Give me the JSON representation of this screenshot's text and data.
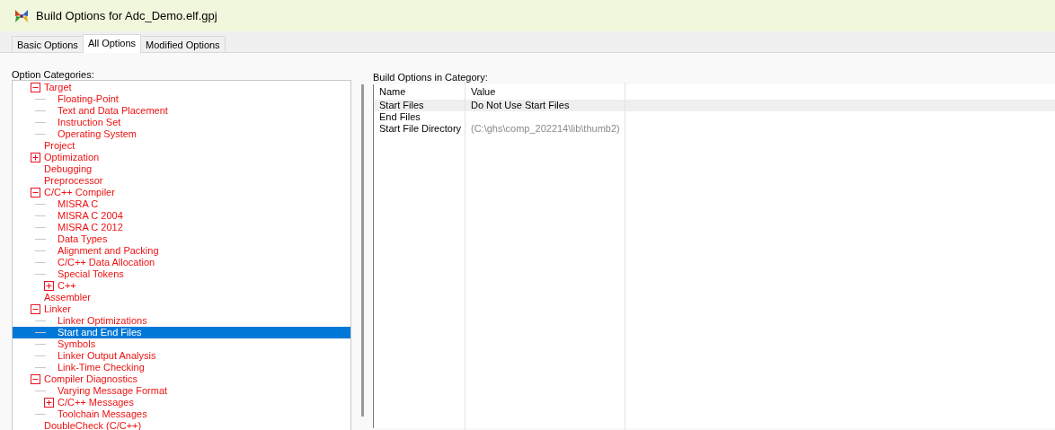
{
  "window": {
    "title": "Build Options for Adc_Demo.elf.gpj"
  },
  "tabs": [
    {
      "label": "Basic Options",
      "selected": false
    },
    {
      "label": "All Options",
      "selected": true
    },
    {
      "label": "Modified Options",
      "selected": false
    }
  ],
  "categories": {
    "label": "Option Categories:",
    "items": [
      {
        "label": "Target",
        "expanded": true,
        "selected": false,
        "children": [
          {
            "label": "Floating-Point",
            "selected": false
          },
          {
            "label": "Text and Data Placement",
            "selected": false
          },
          {
            "label": "Instruction Set",
            "selected": false
          },
          {
            "label": "Operating System",
            "selected": false
          }
        ]
      },
      {
        "label": "Project",
        "selected": false
      },
      {
        "label": "Optimization",
        "expanded": false,
        "selected": false
      },
      {
        "label": "Debugging",
        "selected": false
      },
      {
        "label": "Preprocessor",
        "selected": false
      },
      {
        "label": "C/C++ Compiler",
        "expanded": true,
        "selected": false,
        "children": [
          {
            "label": "MISRA C",
            "selected": false
          },
          {
            "label": "MISRA C 2004",
            "selected": false
          },
          {
            "label": "MISRA C 2012",
            "selected": false
          },
          {
            "label": "Data Types",
            "selected": false
          },
          {
            "label": "Alignment and Packing",
            "selected": false
          },
          {
            "label": "C/C++ Data Allocation",
            "selected": false
          },
          {
            "label": "Special Tokens",
            "selected": false
          },
          {
            "label": "C++",
            "expanded": false,
            "selected": false
          }
        ]
      },
      {
        "label": "Assembler",
        "selected": false
      },
      {
        "label": "Linker",
        "expanded": true,
        "selected": false,
        "children": [
          {
            "label": "Linker Optimizations",
            "selected": false
          },
          {
            "label": "Start and End Files",
            "selected": true
          },
          {
            "label": "Symbols",
            "selected": false
          },
          {
            "label": "Linker Output Analysis",
            "selected": false
          },
          {
            "label": "Link-Time Checking",
            "selected": false
          }
        ]
      },
      {
        "label": "Compiler Diagnostics",
        "expanded": true,
        "selected": false,
        "children": [
          {
            "label": "Varying Message Format",
            "selected": false
          },
          {
            "label": "C/C++ Messages",
            "expanded": false,
            "selected": false
          },
          {
            "label": "Toolchain Messages",
            "selected": false
          }
        ]
      },
      {
        "label": "DoubleCheck (C/C++)",
        "selected": false
      }
    ]
  },
  "options": {
    "label": "Build Options in Category:",
    "columns": [
      "Name",
      "Value"
    ],
    "rows": [
      {
        "name": "Start Files",
        "value": "Do Not Use Start Files",
        "selected": true,
        "inherited": false
      },
      {
        "name": "End Files",
        "selected": false
      },
      {
        "name": "Start File Directory",
        "value": "(C:\\ghs\\comp_202214\\lib\\thumb2)",
        "selected": false,
        "inherited": true
      }
    ]
  }
}
